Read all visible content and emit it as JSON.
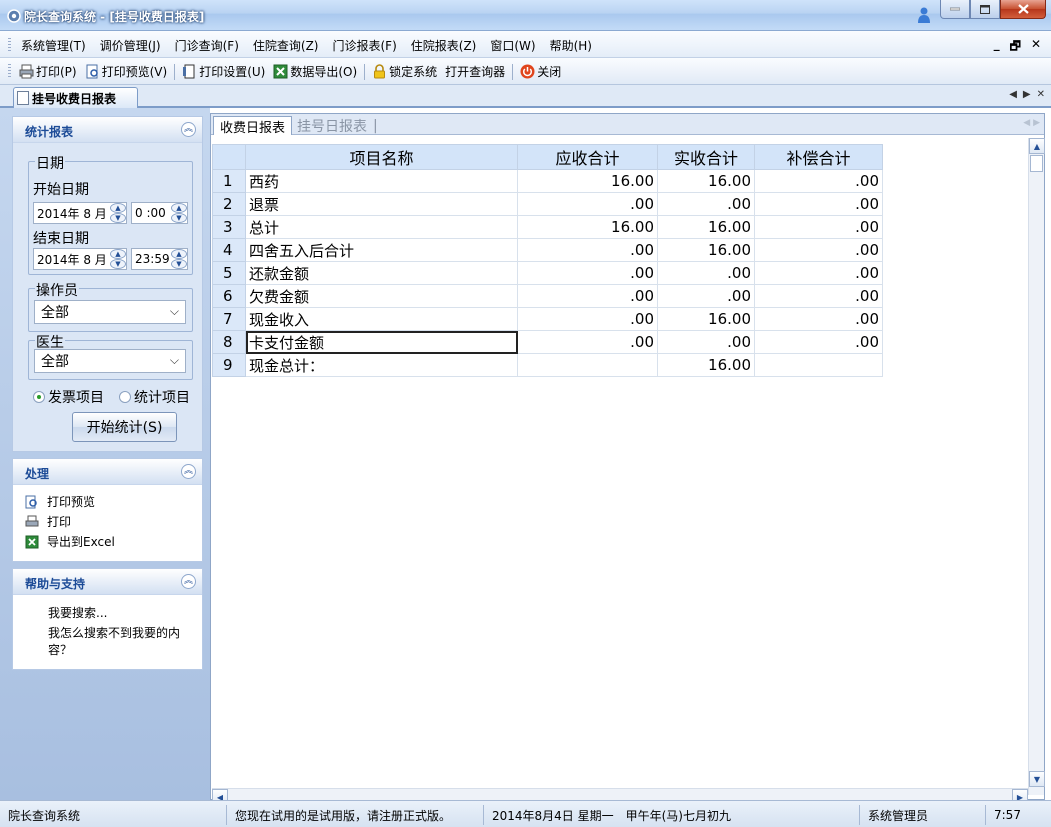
{
  "window": {
    "title": "院长查询系统 - [挂号收费日报表]"
  },
  "menu": {
    "items": [
      "系统管理(T)",
      "调价管理(J)",
      "门诊查询(F)",
      "住院查询(Z)",
      "门诊报表(F)",
      "住院报表(Z)",
      "窗口(W)",
      "帮助(H)"
    ],
    "mdi_controls": [
      "_",
      "🗗",
      "✕"
    ]
  },
  "toolbar": {
    "print": "打印(P)",
    "print_preview": "打印预览(V)",
    "print_setup": "打印设置(U)",
    "export": "数据导出(O)",
    "lock": "锁定系统",
    "open_query": "打开查询器",
    "close": "关闭"
  },
  "doc_tab": {
    "label": "挂号收费日报表"
  },
  "stats_panel": {
    "title": "统计报表",
    "date_group": "日期",
    "start_label": "开始日期",
    "start_date": "2014年 8 月",
    "start_time": "0 :00",
    "end_label": "结束日期",
    "end_date": "2014年 8 月",
    "end_time": "23:59",
    "operator_group": "操作员",
    "operator_value": "全部",
    "doctor_group": "医生",
    "doctor_value": "全部",
    "radio_invoice": "发票项目",
    "radio_stats": "统计项目",
    "start_button": "开始统计(S)"
  },
  "process_panel": {
    "title": "处理",
    "print_preview": "打印预览",
    "print": "打印",
    "export_excel": "导出到Excel"
  },
  "help_panel": {
    "title": "帮助与支持",
    "search": "我要搜索...",
    "faq": "我怎么搜索不到我要的内容？"
  },
  "report_tabs": {
    "active": "收费日报表",
    "inactive": "挂号日报表"
  },
  "grid": {
    "columns": [
      "项目名称",
      "应收合计",
      "实收合计",
      "补偿合计"
    ],
    "rows": [
      {
        "n": "1",
        "name": "西药",
        "due": "16.00",
        "paid": "16.00",
        "comp": ".00"
      },
      {
        "n": "2",
        "name": "退票",
        "due": ".00",
        "paid": ".00",
        "comp": ".00"
      },
      {
        "n": "3",
        "name": "总计",
        "due": "16.00",
        "paid": "16.00",
        "comp": ".00"
      },
      {
        "n": "4",
        "name": "四舍五入后合计",
        "due": ".00",
        "paid": "16.00",
        "comp": ".00"
      },
      {
        "n": "5",
        "name": "还款金额",
        "due": ".00",
        "paid": ".00",
        "comp": ".00"
      },
      {
        "n": "6",
        "name": "欠费金额",
        "due": ".00",
        "paid": ".00",
        "comp": ".00"
      },
      {
        "n": "7",
        "name": "现金收入",
        "due": ".00",
        "paid": "16.00",
        "comp": ".00"
      },
      {
        "n": "8",
        "name": "卡支付金额",
        "due": ".00",
        "paid": ".00",
        "comp": ".00"
      },
      {
        "n": "9",
        "name": "现金总计：",
        "due": "",
        "paid": "16.00",
        "comp": ""
      }
    ]
  },
  "statusbar": {
    "app": "院长查询系统",
    "trial": "您现在试用的是试用版，请注册正式版。",
    "date": "2014年8月4日 星期一　甲午年(马)七月初九",
    "user": "系统管理员",
    "time": "7:57"
  },
  "colors": {
    "accent": "#1c4b97",
    "header_bg": "#d3e4f9",
    "pane_bg": "#a8bfe0"
  }
}
